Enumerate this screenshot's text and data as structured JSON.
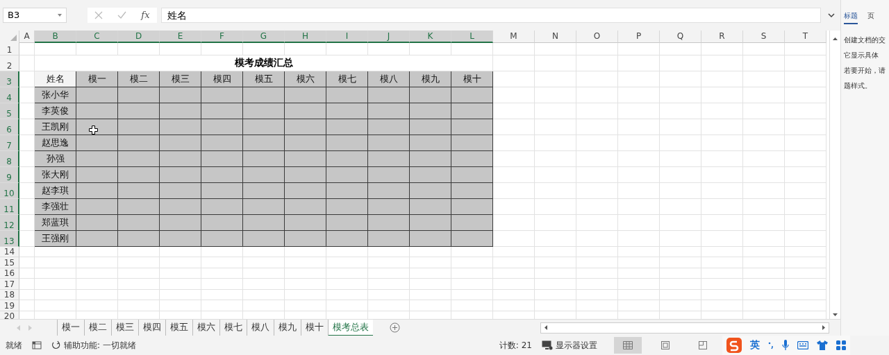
{
  "name_box": {
    "value": "B3"
  },
  "formula_bar": {
    "function_label": "fx",
    "value": "姓名"
  },
  "columns": [
    {
      "label": "A",
      "selected": false
    },
    {
      "label": "B",
      "selected": true
    },
    {
      "label": "C",
      "selected": true
    },
    {
      "label": "D",
      "selected": true
    },
    {
      "label": "E",
      "selected": true
    },
    {
      "label": "F",
      "selected": true
    },
    {
      "label": "G",
      "selected": true
    },
    {
      "label": "H",
      "selected": true
    },
    {
      "label": "I",
      "selected": true
    },
    {
      "label": "J",
      "selected": true
    },
    {
      "label": "K",
      "selected": true
    },
    {
      "label": "L",
      "selected": true
    },
    {
      "label": "M",
      "selected": false
    },
    {
      "label": "N",
      "selected": false
    },
    {
      "label": "O",
      "selected": false
    },
    {
      "label": "P",
      "selected": false
    },
    {
      "label": "Q",
      "selected": false
    },
    {
      "label": "R",
      "selected": false
    },
    {
      "label": "S",
      "selected": false
    },
    {
      "label": "T",
      "selected": false
    }
  ],
  "rows": [
    {
      "label": "1",
      "selected": false
    },
    {
      "label": "2",
      "selected": false
    },
    {
      "label": "3",
      "selected": true
    },
    {
      "label": "4",
      "selected": true
    },
    {
      "label": "5",
      "selected": true
    },
    {
      "label": "6",
      "selected": true
    },
    {
      "label": "7",
      "selected": true
    },
    {
      "label": "8",
      "selected": true
    },
    {
      "label": "9",
      "selected": true
    },
    {
      "label": "10",
      "selected": true
    },
    {
      "label": "11",
      "selected": true
    },
    {
      "label": "12",
      "selected": true
    },
    {
      "label": "13",
      "selected": true
    },
    {
      "label": "14",
      "selected": false
    },
    {
      "label": "15",
      "selected": false
    },
    {
      "label": "16",
      "selected": false
    },
    {
      "label": "17",
      "selected": false
    },
    {
      "label": "18",
      "selected": false
    },
    {
      "label": "19",
      "selected": false
    },
    {
      "label": "20",
      "selected": false
    }
  ],
  "title": "模考成绩汇总",
  "table": {
    "header": [
      {
        "text": "姓名",
        "active": true
      },
      {
        "text": "模一",
        "active": false
      },
      {
        "text": "模二",
        "active": false
      },
      {
        "text": "模三",
        "active": false
      },
      {
        "text": "模四",
        "active": false
      },
      {
        "text": "模五",
        "active": false
      },
      {
        "text": "模六",
        "active": false
      },
      {
        "text": "模七",
        "active": false
      },
      {
        "text": "模八",
        "active": false
      },
      {
        "text": "模九",
        "active": false
      },
      {
        "text": "模十",
        "active": false
      }
    ],
    "names": [
      "张小华",
      "李英俊",
      "王凯刚",
      "赵思逸",
      "孙强",
      "张大刚",
      "赵李琪",
      "李强壮",
      "郑蓝琪",
      "王强刚"
    ]
  },
  "sheet_tabs": [
    {
      "label": "模一",
      "selected": false
    },
    {
      "label": "模二",
      "selected": false
    },
    {
      "label": "模三",
      "selected": false
    },
    {
      "label": "模四",
      "selected": false
    },
    {
      "label": "模五",
      "selected": false
    },
    {
      "label": "模六",
      "selected": false
    },
    {
      "label": "模七",
      "selected": false
    },
    {
      "label": "模八",
      "selected": false
    },
    {
      "label": "模九",
      "selected": false
    },
    {
      "label": "模十",
      "selected": false
    },
    {
      "label": "模考总表",
      "selected": true
    }
  ],
  "status_bar": {
    "mode": "就绪",
    "accessibility": "辅助功能: 一切就绪",
    "count": "计数: 21",
    "display_settings": "显示器设置",
    "views": [
      {
        "kind": "normal",
        "selected": true
      },
      {
        "kind": "page_layout",
        "selected": false
      },
      {
        "kind": "page_break",
        "selected": false
      }
    ]
  },
  "ime": {
    "language": "英"
  },
  "side_pane": {
    "tabs": [
      {
        "label": "标题",
        "selected": true
      },
      {
        "label": "页",
        "selected": false
      }
    ],
    "lines": [
      "创建文档的交",
      "它显示具体",
      "若要开始，请",
      "题样式。"
    ]
  }
}
